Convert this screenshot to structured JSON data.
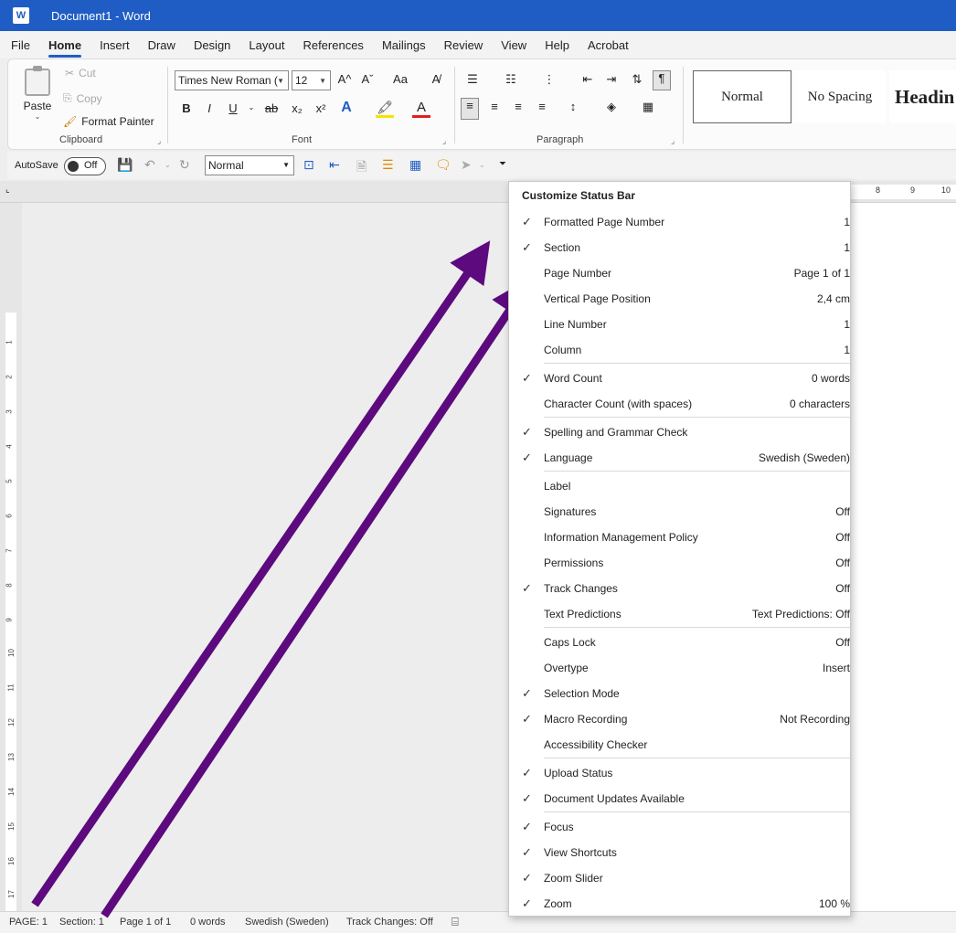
{
  "window": {
    "title": "Document1  -  Word",
    "app_icon": "word-logo-icon"
  },
  "tabs": [
    "File",
    "Home",
    "Insert",
    "Draw",
    "Design",
    "Layout",
    "References",
    "Mailings",
    "Review",
    "View",
    "Help",
    "Acrobat"
  ],
  "active_tab": "Home",
  "ribbon": {
    "clipboard": {
      "paste": "Paste",
      "cut": "Cut",
      "copy": "Copy",
      "format_painter": "Format Painter",
      "group_label": "Clipboard"
    },
    "font": {
      "family": "Times New Roman (",
      "size": "12",
      "group_label": "Font",
      "bold": "B",
      "italic": "I",
      "underline": "U",
      "strike": "ab",
      "sub": "x₂",
      "sup": "x²",
      "grow": "A^",
      "shrink": "Aˇ",
      "case": "Aa"
    },
    "paragraph": {
      "group_label": "Paragraph"
    },
    "styles": [
      "Normal",
      "No Spacing",
      "Headin"
    ]
  },
  "qat": {
    "autosave_label": "AutoSave",
    "autosave_state": "Off",
    "style_value": "Normal"
  },
  "ruler": {
    "h_marks": [
      "8",
      "9",
      "10"
    ],
    "v_marks": [
      "1",
      "2",
      "3",
      "4",
      "5",
      "6",
      "7",
      "8",
      "9",
      "10",
      "11",
      "12",
      "13",
      "14",
      "15",
      "16",
      "17"
    ]
  },
  "statusbar": {
    "page": "PAGE: 1",
    "section": "Section: 1",
    "page_of": "Page 1 of 1",
    "words": "0 words",
    "language": "Swedish (Sweden)",
    "track_changes": "Track Changes: Off"
  },
  "menu": {
    "title": "Customize Status Bar",
    "items": [
      {
        "label": "Formatted Page Number",
        "value": "1",
        "checked": true
      },
      {
        "label": "Section",
        "value": "1",
        "checked": true
      },
      {
        "label": "Page Number",
        "value": "Page 1 of 1",
        "checked": false
      },
      {
        "label": "Vertical Page Position",
        "value": "2,4 cm",
        "checked": false
      },
      {
        "label": "Line Number",
        "value": "1",
        "checked": false
      },
      {
        "label": "Column",
        "value": "1",
        "checked": false
      },
      {
        "label": "Word Count",
        "value": "0 words",
        "checked": true
      },
      {
        "label": "Character Count (with spaces)",
        "value": "0 characters",
        "checked": false
      },
      {
        "label": "Spelling and Grammar Check",
        "value": "",
        "checked": true
      },
      {
        "label": "Language",
        "value": "Swedish (Sweden)",
        "checked": true
      },
      {
        "label": "Label",
        "value": "",
        "checked": false
      },
      {
        "label": "Signatures",
        "value": "Off",
        "checked": false
      },
      {
        "label": "Information Management Policy",
        "value": "Off",
        "checked": false
      },
      {
        "label": "Permissions",
        "value": "Off",
        "checked": false
      },
      {
        "label": "Track Changes",
        "value": "Off",
        "checked": true
      },
      {
        "label": "Text Predictions",
        "value": "Text Predictions: Off",
        "checked": false
      },
      {
        "label": "Caps Lock",
        "value": "Off",
        "checked": false
      },
      {
        "label": "Overtype",
        "value": "Insert",
        "checked": false
      },
      {
        "label": "Selection Mode",
        "value": "",
        "checked": true
      },
      {
        "label": "Macro Recording",
        "value": "Not Recording",
        "checked": true
      },
      {
        "label": "Accessibility Checker",
        "value": "",
        "checked": false
      },
      {
        "label": "Upload Status",
        "value": "",
        "checked": true
      },
      {
        "label": "Document Updates Available",
        "value": "",
        "checked": true
      },
      {
        "label": "Focus",
        "value": "",
        "checked": true
      },
      {
        "label": "View Shortcuts",
        "value": "",
        "checked": true
      },
      {
        "label": "Zoom Slider",
        "value": "",
        "checked": true
      },
      {
        "label": "Zoom",
        "value": "100 %",
        "checked": true
      }
    ]
  },
  "colors": {
    "titlebar": "#1f5dc4",
    "arrow": "#5c0a7e",
    "font_color": "#e02020",
    "highlight": "#f2e600"
  }
}
